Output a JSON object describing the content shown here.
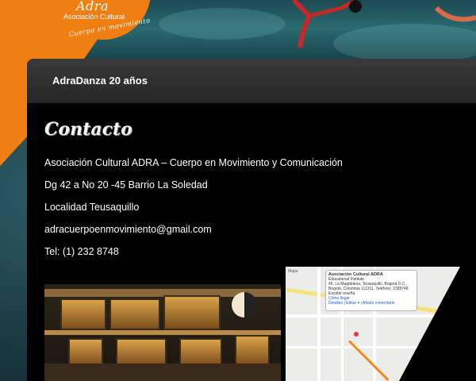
{
  "logo": {
    "name": "Adra",
    "subtitle": "Asociación Cultural",
    "tagline": "Cuerpo en movimiento"
  },
  "header": {
    "site_title": "AdraDanza 20 años"
  },
  "page": {
    "title": "Contacto",
    "lines": [
      "Asociación Cultural ADRA – Cuerpo en Movimiento y Comunicación",
      "Dg 42 a No 20 -45 Barrio La Soledad",
      "Localidad Teusaquillo",
      "adracuerpoenmovimiento@gmail.com",
      "Tel: (1) 232 8748"
    ]
  },
  "map": {
    "control_label": "Mapa",
    "bubble_title": "Asociación Cultural ADRA",
    "bubble_sub": "Educational Institute",
    "bubble_addr": "45, La Magdalena, Teusaquillo, Bogotá D.C., Bogotá, Colombia 111311, Teléfono: 2328748",
    "bubble_rating": "Escribir reseña",
    "bubble_links": "Cómo llegar",
    "bubble_foot": "Detalles | Editar ▾ | Añadir comentario"
  },
  "colors": {
    "brand_orange": "#f07f12",
    "header_bg": "#2e2e2e",
    "content_bg": "#000000",
    "text": "#ffffff"
  }
}
